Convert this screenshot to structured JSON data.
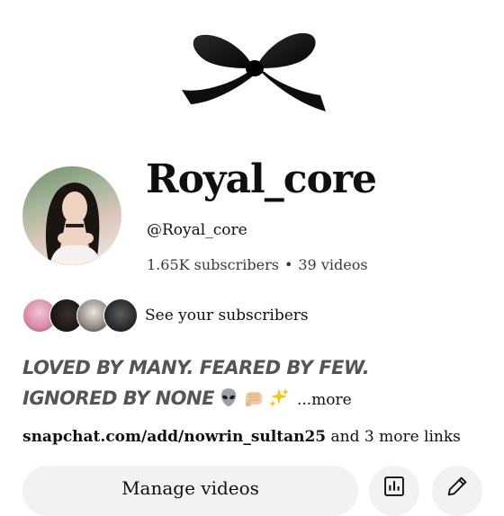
{
  "banner": {
    "icon": "ribbon-bow-icon"
  },
  "channel": {
    "name": "Royal_core",
    "handle": "@Royal_core",
    "subscribers": "1.65K subscribers",
    "separator": "•",
    "videos": "39 videos"
  },
  "subscribers_preview": {
    "label": "See your subscribers"
  },
  "description": {
    "line1": "LOVED BY MANY. FEARED BY FEW.",
    "line2": "IGNORED BY NONE",
    "emojis": [
      "alien-emoji-icon",
      "fist-bump-emoji-icon",
      "sparkles-emoji-icon"
    ],
    "more_label": "...more"
  },
  "links": {
    "primary": "snapchat.com/add/nowrin_sultan25",
    "more": "and 3 more links"
  },
  "actions": {
    "manage_label": "Manage videos",
    "analytics_icon": "analytics-icon",
    "edit_icon": "edit-pencil-icon"
  },
  "colors": {
    "text": "#0f0f0f",
    "secondary_text": "#555555",
    "button_bg": "#f2f2f2",
    "bow": "#111111"
  }
}
